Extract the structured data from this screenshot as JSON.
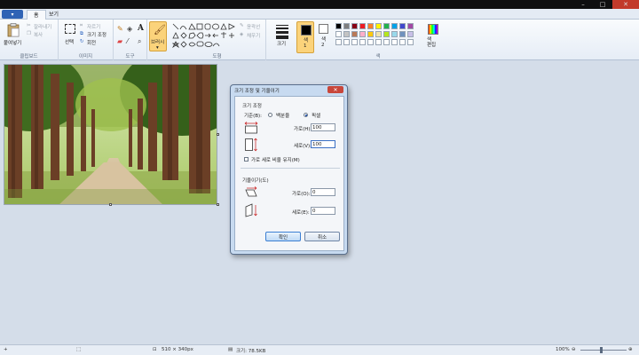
{
  "menu": {
    "label": "▾"
  },
  "tabs": [
    {
      "label": "홈"
    },
    {
      "label": "보기"
    }
  ],
  "ribbon": {
    "clipboard": {
      "paste": "붙여넣기",
      "cut": "잘라내기",
      "copy": "복사",
      "label": "클립보드"
    },
    "image": {
      "select": "선택",
      "crop": "자르기",
      "resize": "크기 조정",
      "rotate": "회전",
      "label": "이미지"
    },
    "tools": {
      "label": "도구"
    },
    "brushes": {
      "label": "브러시"
    },
    "shapes": {
      "outline": "윤곽선",
      "fill": "채우기",
      "label": "도형"
    },
    "size": {
      "label": "크기"
    },
    "color1": {
      "label": "색\n1"
    },
    "color2": {
      "label": "색\n2"
    },
    "colors": {
      "label": "색"
    },
    "edit_colors": {
      "label": "색\n편집"
    }
  },
  "palette": [
    "#000000",
    "#7f7f7f",
    "#880015",
    "#ed1c24",
    "#ff7f27",
    "#fff200",
    "#22b14c",
    "#00a2e8",
    "#3f48cc",
    "#a349a4",
    "#ffffff",
    "#c3c3c3",
    "#b97a57",
    "#ffaec9",
    "#ffc90e",
    "#efe4b0",
    "#b5e61d",
    "#99d9ea",
    "#7092be",
    "#c8bfe7"
  ],
  "dialog": {
    "title": "크기 조정 및 기울이기",
    "resize_section": "크기 조정",
    "by_label": "기준(B):",
    "percent_label": "백분율",
    "pixels_label": "픽셀",
    "horizontal_label": "가로(H):",
    "horizontal_value": "100",
    "vertical_label": "세로(V):",
    "vertical_value": "100",
    "keep_ratio": "가로 세로 비율 유지(M)",
    "skew_section": "기울이기(도)",
    "skew_h_label": "가로(O):",
    "skew_h_value": "0",
    "skew_v_label": "세로(E):",
    "skew_v_value": "0",
    "ok": "확인",
    "cancel": "취소"
  },
  "status": {
    "dimensions": "510 × 340px",
    "filesize": "크기: 78.5KB",
    "zoom": "100%"
  }
}
